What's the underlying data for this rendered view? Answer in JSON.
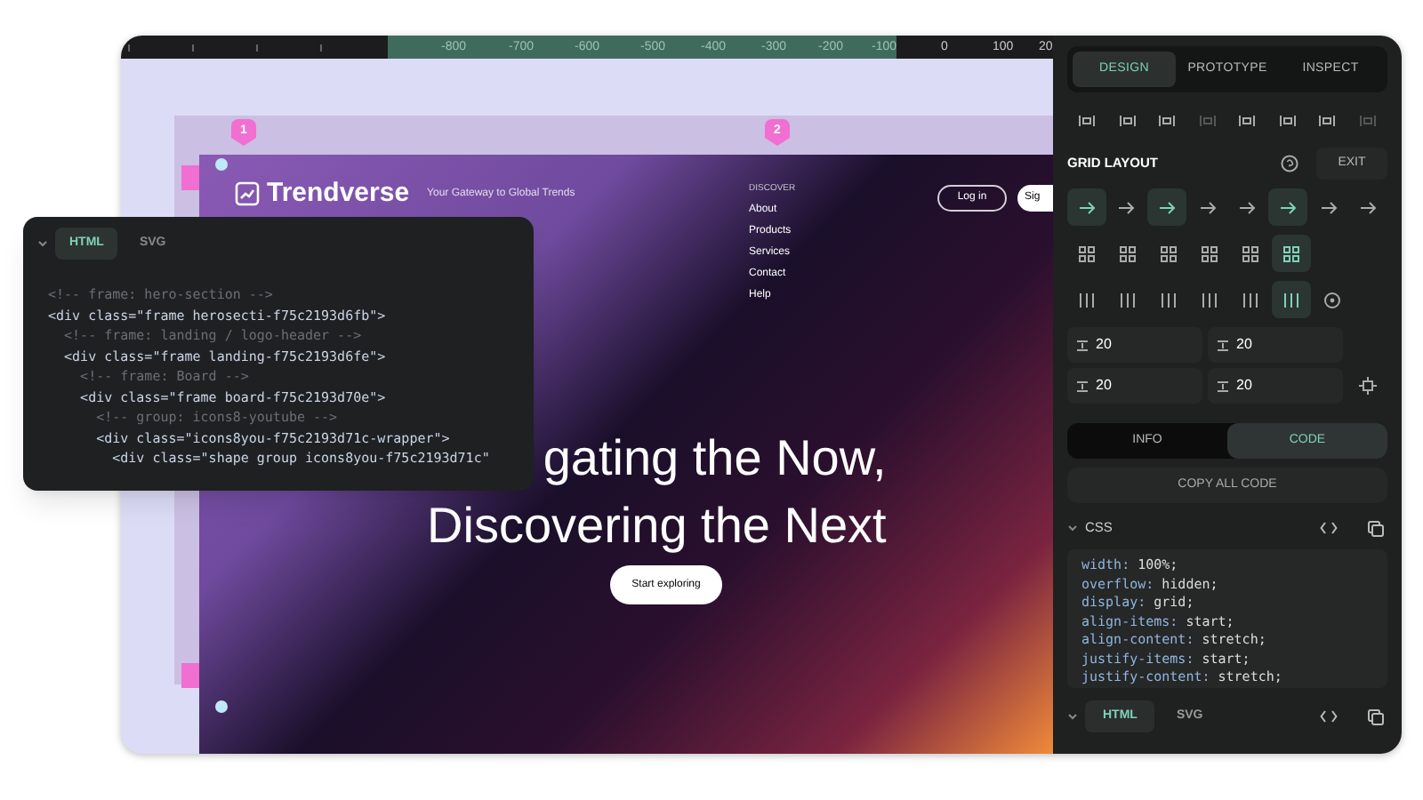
{
  "ruler": {
    "labels": [
      "-800",
      "-700",
      "-600",
      "-500",
      "-400",
      "-300",
      "-200",
      "-100",
      "0",
      "100",
      "20"
    ]
  },
  "canvas": {
    "markers": [
      "1",
      "2"
    ],
    "site": {
      "logo": "Trendverse",
      "tagline": "Your Gateway to Global Trends",
      "nav_heading": "DISCOVER",
      "nav": [
        "About",
        "Products",
        "Services",
        "Contact",
        "Help"
      ],
      "login": "Log in",
      "signup": "Sig",
      "headline": [
        "gating the Now,",
        "Discovering the Next"
      ],
      "cta": "Start exploring"
    }
  },
  "code_popup": {
    "tabs": [
      {
        "label": "HTML",
        "selected": true
      },
      {
        "label": "SVG",
        "selected": false
      }
    ],
    "lines": [
      {
        "kind": "comment",
        "text": "<!-- frame: hero-section -->"
      },
      {
        "kind": "tag",
        "text": "<div class=\"frame herosecti-f75c2193d6fb\">"
      },
      {
        "kind": "comment",
        "text": "  <!-- frame: landing / logo-header -->"
      },
      {
        "kind": "tag",
        "text": "  <div class=\"frame landing-f75c2193d6fe\">"
      },
      {
        "kind": "comment",
        "text": "    <!-- frame: Board -->"
      },
      {
        "kind": "tag",
        "text": "    <div class=\"frame board-f75c2193d70e\">"
      },
      {
        "kind": "comment",
        "text": "      <!-- group: icons8-youtube -->"
      },
      {
        "kind": "tag",
        "text": "      <div class=\"icons8you-f75c2193d71c-wrapper\">"
      },
      {
        "kind": "tag",
        "text": "        <div class=\"shape group icons8you-f75c2193d71c\""
      }
    ]
  },
  "panel": {
    "tabs": [
      {
        "label": "DESIGN",
        "selected": true
      },
      {
        "label": "PROTOTYPE",
        "selected": false
      },
      {
        "label": "INSPECT",
        "selected": false
      }
    ],
    "align_row": [
      {
        "disabled": false
      },
      {
        "disabled": false
      },
      {
        "disabled": false
      },
      {
        "disabled": true
      },
      {
        "disabled": false
      },
      {
        "disabled": false
      },
      {
        "disabled": false
      },
      {
        "disabled": true
      }
    ],
    "grid_layout": {
      "title": "GRID LAYOUT",
      "exit": "EXIT",
      "direction_row": [
        {
          "selected": true
        },
        {
          "selected": false
        },
        {
          "selected": true
        },
        {
          "selected": false
        },
        {
          "selected": false
        },
        {
          "selected": true
        },
        {
          "selected": false
        },
        {
          "selected": false
        }
      ],
      "template_row": [
        {
          "selected": false
        },
        {
          "selected": false
        },
        {
          "selected": false
        },
        {
          "selected": false
        },
        {
          "selected": false
        },
        {
          "selected": true
        }
      ],
      "column_row": [
        {
          "selected": false
        },
        {
          "selected": false
        },
        {
          "selected": false
        },
        {
          "selected": false
        },
        {
          "selected": false
        },
        {
          "selected": true
        }
      ],
      "gaps": [
        "20",
        "20",
        "20",
        "20"
      ]
    },
    "view_tabs": [
      {
        "label": "INFO",
        "selected": false
      },
      {
        "label": "CODE",
        "selected": true
      }
    ],
    "copy_button": "COPY ALL CODE",
    "css": {
      "title": "CSS",
      "lines": [
        [
          "width:",
          "100%;"
        ],
        [
          "overflow:",
          "hidden;"
        ],
        [
          "display:",
          "grid;"
        ],
        [
          "align-items:",
          "start;"
        ],
        [
          "align-content:",
          "stretch;"
        ],
        [
          "justify-items:",
          "start;"
        ],
        [
          "justify-content:",
          "stretch;"
        ]
      ]
    },
    "bottom_tabs": [
      {
        "label": "HTML",
        "selected": true
      },
      {
        "label": "SVG",
        "selected": false
      }
    ]
  }
}
